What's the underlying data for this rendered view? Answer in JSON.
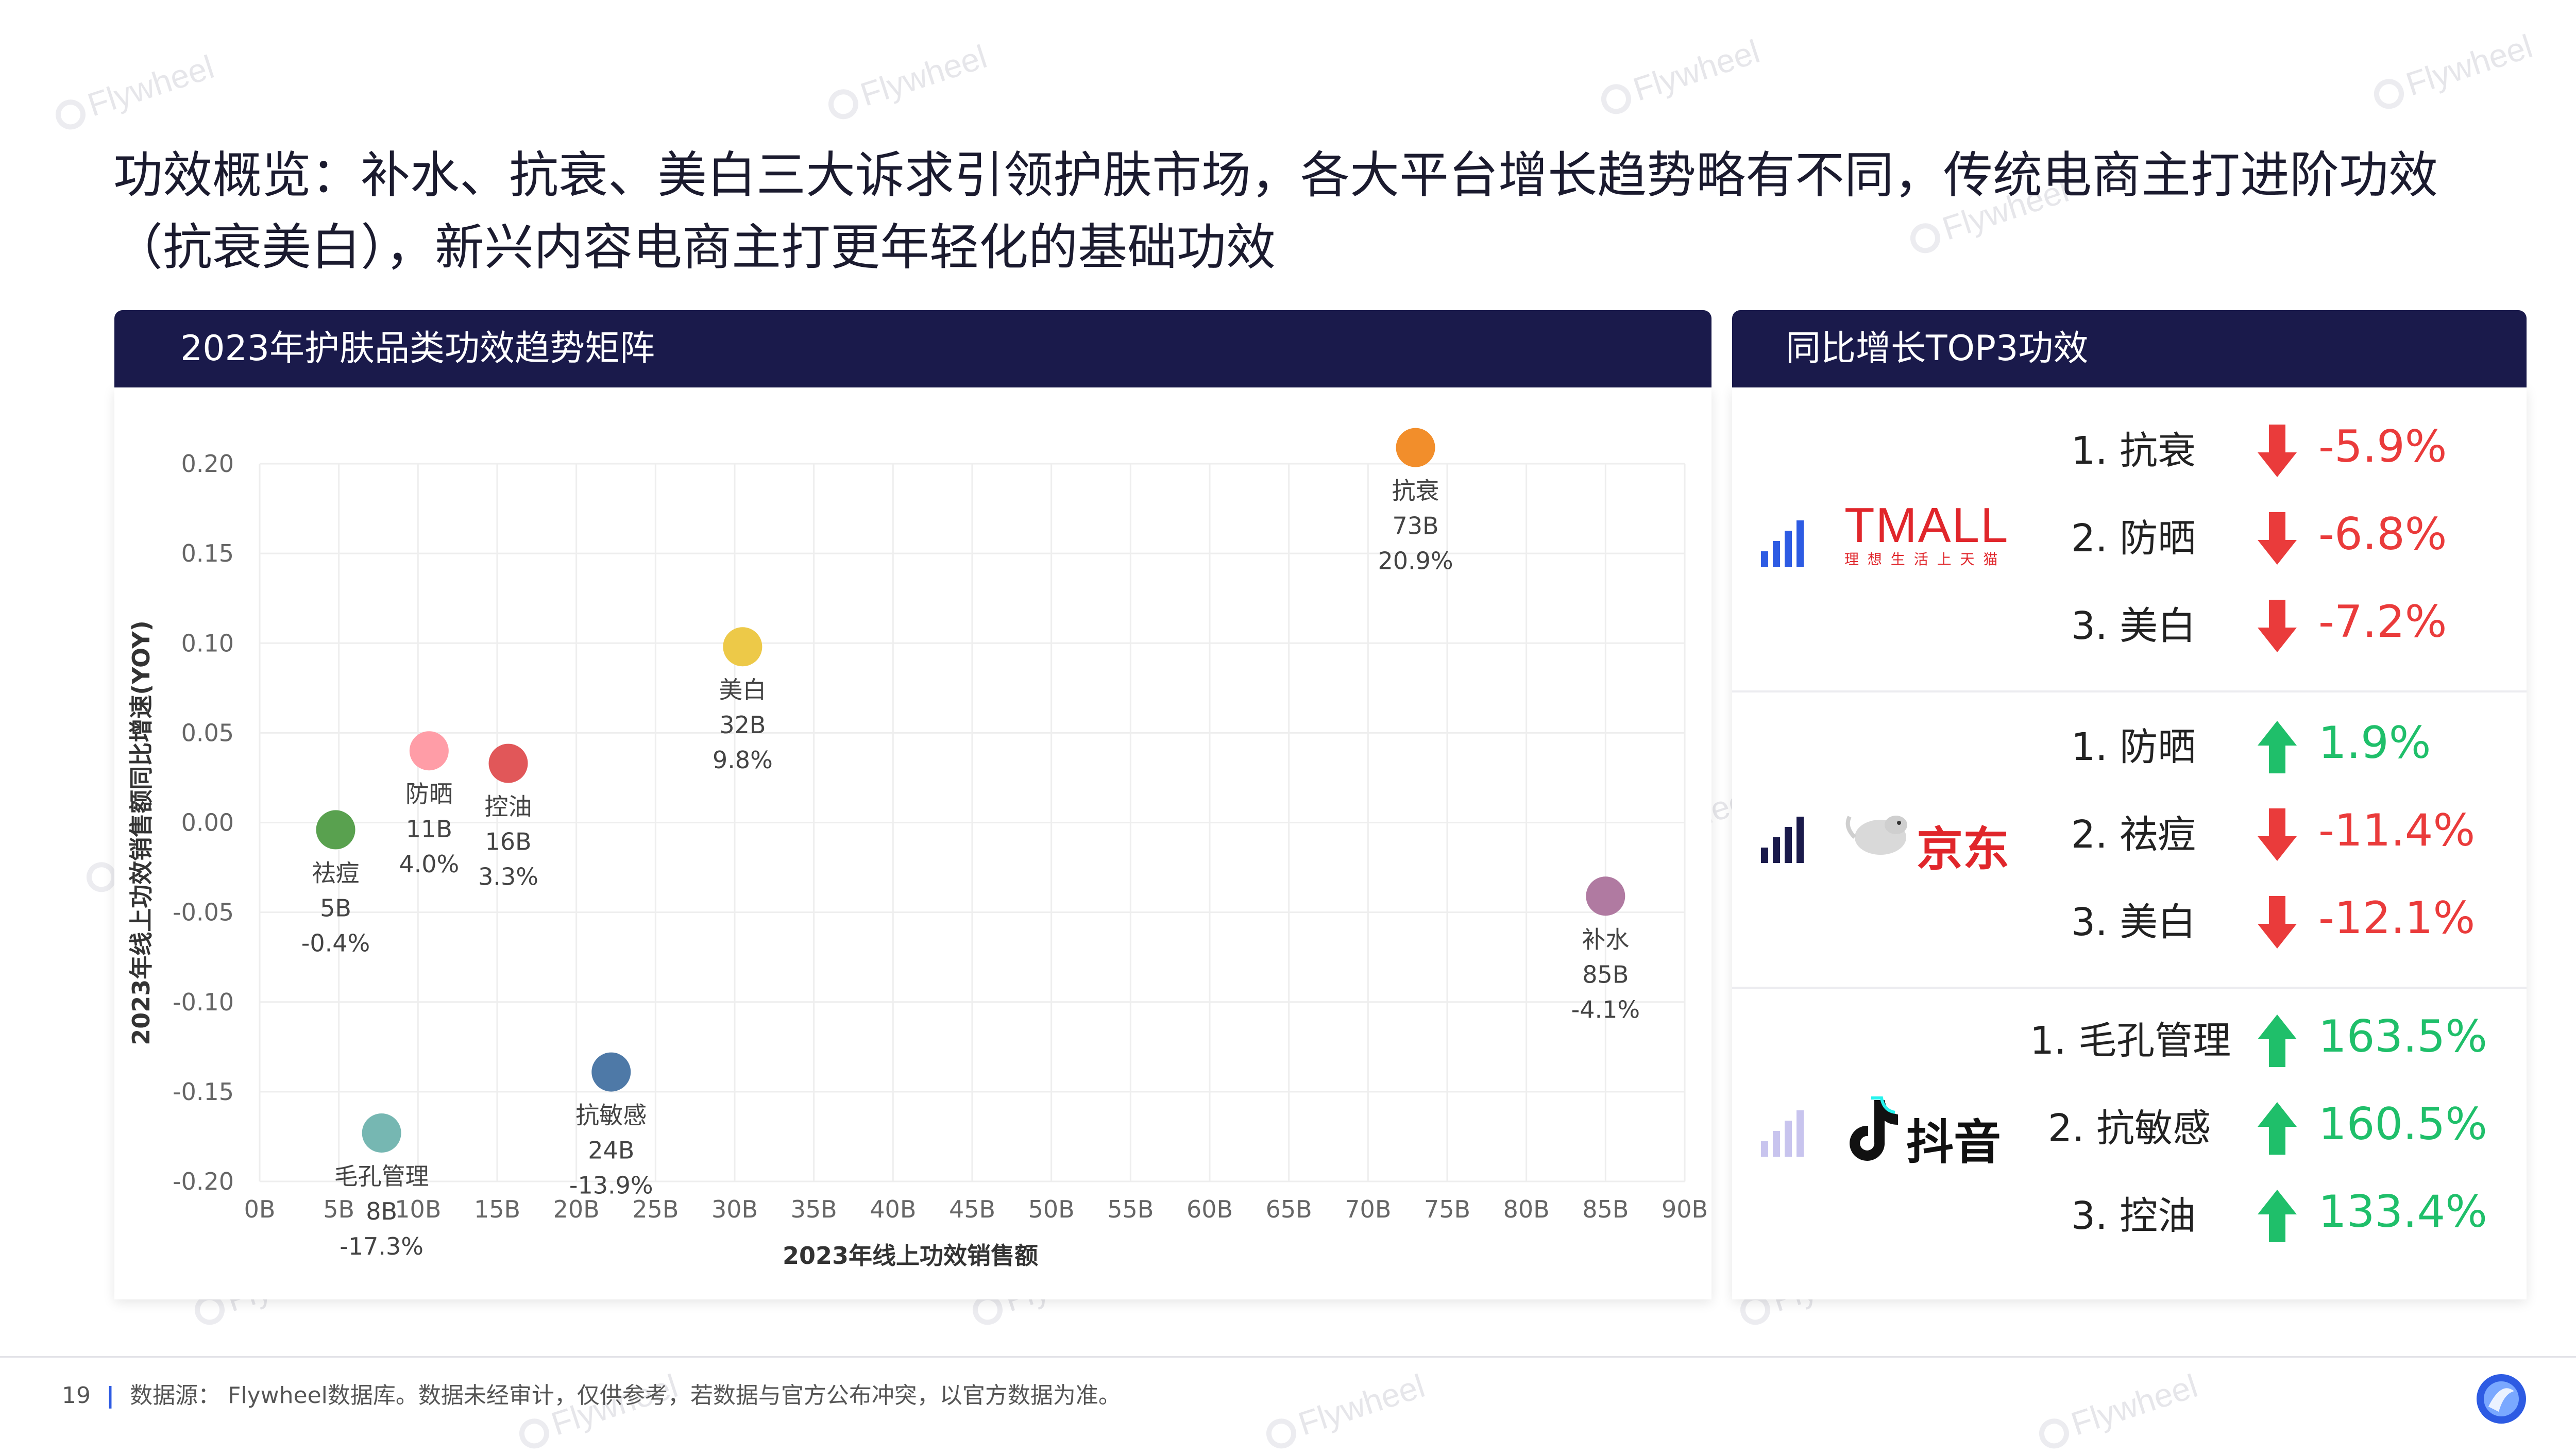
{
  "page": {
    "title": "功效概览：补水、抗衰、美白三大诉求引领护肤市场，各大平台增长趋势略有不同，传统电商主打进阶功效（抗衰美白），新兴内容电商主打更年轻化的基础功效",
    "watermark": "Flywheel",
    "page_number": "19",
    "footer_source": "数据源： Flywheel数据库。数据未经审计，仅供参考，若数据与官方公布冲突，以官方数据为准。"
  },
  "left_panel": {
    "header": "2023年护肤品类功效趋势矩阵"
  },
  "right_panel": {
    "header": "同比增长TOP3功效"
  },
  "chart_data": {
    "type": "scatter",
    "title": "2023年护肤品类功效趋势矩阵",
    "xlabel": "2023年线上功效销售额",
    "ylabel": "2023年线上功效销售额同比增速(YOY)",
    "xlim": [
      0,
      90
    ],
    "ylim": [
      -0.2,
      0.2
    ],
    "x_ticks": [
      "0B",
      "5B",
      "10B",
      "15B",
      "20B",
      "25B",
      "30B",
      "35B",
      "40B",
      "45B",
      "50B",
      "55B",
      "60B",
      "65B",
      "70B",
      "75B",
      "80B",
      "85B",
      "90B"
    ],
    "y_ticks": [
      "0.20",
      "0.15",
      "0.10",
      "0.05",
      "0.00",
      "-0.05",
      "-0.10",
      "-0.15",
      "-0.20"
    ],
    "grid": true,
    "points": [
      {
        "name": "抗衰",
        "x": 73,
        "y": 0.209,
        "sales": "73B",
        "yoy": "20.9%",
        "color": "#f28e2b"
      },
      {
        "name": "美白",
        "x": 30.5,
        "y": 0.098,
        "sales": "32B",
        "yoy": "9.8%",
        "color": "#edc948"
      },
      {
        "name": "防晒",
        "x": 10.7,
        "y": 0.04,
        "sales": "11B",
        "yoy": "4.0%",
        "color": "#ff9da7"
      },
      {
        "name": "控油",
        "x": 15.7,
        "y": 0.033,
        "sales": "16B",
        "yoy": "3.3%",
        "color": "#e15759"
      },
      {
        "name": "祛痘",
        "x": 4.8,
        "y": -0.004,
        "sales": "5B",
        "yoy": "-0.4%",
        "color": "#59a14f"
      },
      {
        "name": "补水",
        "x": 85,
        "y": -0.041,
        "sales": "85B",
        "yoy": "-4.1%",
        "color": "#b07aa1"
      },
      {
        "name": "抗敏感",
        "x": 22.2,
        "y": -0.139,
        "sales": "24B",
        "yoy": "-13.9%",
        "color": "#4e79a7"
      },
      {
        "name": "毛孔管理",
        "x": 7.7,
        "y": -0.173,
        "sales": "8B",
        "yoy": "-17.3%",
        "color": "#76b7b2"
      }
    ]
  },
  "platforms": [
    {
      "name": "TMALL",
      "logo_text": "TMALL",
      "logo_sub": "理 想 生 活 上 天 猫",
      "bar_color": "#2d5be3",
      "items": [
        {
          "rank": "1.",
          "name": "抗衰",
          "value": "-5.9%",
          "dir": "down"
        },
        {
          "rank": "2.",
          "name": "防晒",
          "value": "-6.8%",
          "dir": "down"
        },
        {
          "rank": "3.",
          "name": "美白",
          "value": "-7.2%",
          "dir": "down"
        }
      ]
    },
    {
      "name": "京东",
      "logo_text": "京东",
      "bar_color": "#1a1a4b",
      "items": [
        {
          "rank": "1.",
          "name": "防晒",
          "value": "1.9%",
          "dir": "up"
        },
        {
          "rank": "2.",
          "name": "祛痘",
          "value": "-11.4%",
          "dir": "down"
        },
        {
          "rank": "3.",
          "name": "美白",
          "value": "-12.1%",
          "dir": "down"
        }
      ]
    },
    {
      "name": "抖音",
      "logo_text": "抖音",
      "bar_color": "#c8c4ee",
      "items": [
        {
          "rank": "1.",
          "name": "毛孔管理",
          "value": "163.5%",
          "dir": "up"
        },
        {
          "rank": "2.",
          "name": "抗敏感",
          "value": "160.5%",
          "dir": "up"
        },
        {
          "rank": "3.",
          "name": "控油",
          "value": "133.4%",
          "dir": "up"
        }
      ]
    }
  ],
  "colors": {
    "up": "#1fbf6a",
    "down": "#ea3b3b",
    "header_bg": "#1a1a4b"
  }
}
